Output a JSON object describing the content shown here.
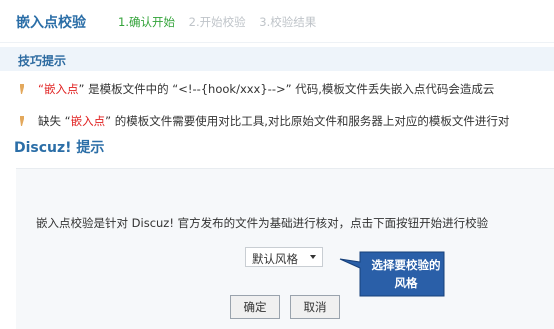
{
  "header": {
    "title": "嵌入点校验",
    "steps": [
      {
        "label": "1.确认开始",
        "state": "active"
      },
      {
        "label": "2.开始校验",
        "state": "inactive"
      },
      {
        "label": "3.校验结果",
        "state": "inactive"
      }
    ]
  },
  "tips": {
    "title": "技巧提示",
    "line1": {
      "q_open": "“",
      "highlight": "嵌入点",
      "rest": "” 是模板文件中的 “<!--{hook/xxx}-->” 代码,模板文件丢失嵌入点代码会造成云"
    },
    "line2": {
      "prefix": "缺失 “",
      "highlight": "嵌入点",
      "rest": "” 的模板文件需要使用对比工具,对比原始文件和服务器上对应的模板文件进行对"
    }
  },
  "discuz_title": "Discuz! 提示",
  "panel": {
    "description": "嵌入点校验是针对 Discuz! 官方发布的文件为基础进行核对，点击下面按钮开始进行校验",
    "select_value": "默认风格",
    "callout": "选择要校验的风格",
    "confirm_label": "确定",
    "cancel_label": "取消"
  },
  "colors": {
    "accent_blue": "#2b6ea7",
    "step_active": "#33a33a",
    "highlight_red": "#e02020",
    "callout_bg": "#2a5fa8"
  },
  "icons": {
    "bullet": "bullet-icon",
    "select_arrow": "dropdown-arrow-icon"
  }
}
